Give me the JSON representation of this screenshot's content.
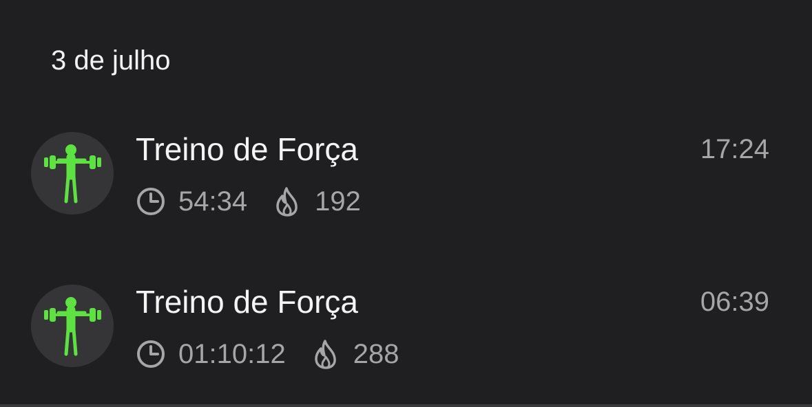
{
  "section": {
    "date_label": "3 de julho"
  },
  "workouts": [
    {
      "title": "Treino de Força",
      "time": "17:24",
      "duration": "54:34",
      "calories": "192",
      "icon": "strength-training-icon"
    },
    {
      "title": "Treino de Força",
      "time": "06:39",
      "duration": "01:10:12",
      "calories": "288",
      "icon": "strength-training-icon"
    }
  ],
  "colors": {
    "background": "#1f1f21",
    "accent": "#5ce33f",
    "secondary_text": "#a6a6a8",
    "avatar_bg": "#353538"
  }
}
